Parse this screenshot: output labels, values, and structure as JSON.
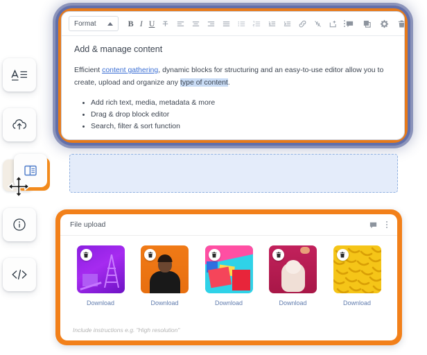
{
  "sidebar": {
    "items": [
      {
        "name": "text-format",
        "label": "Text formatting block"
      },
      {
        "name": "cloud-upload",
        "label": "File upload block"
      },
      {
        "name": "layout-blocks",
        "label": "Layout block"
      },
      {
        "name": "info",
        "label": "Info block"
      },
      {
        "name": "code",
        "label": "Code block"
      }
    ],
    "dragging_item": "layout-blocks",
    "cursor": "move"
  },
  "editor": {
    "toolbar": {
      "format_label": "Format",
      "format_caret": "caret-up",
      "buttons": [
        {
          "name": "bold",
          "glyph": "B"
        },
        {
          "name": "italic",
          "glyph": "I"
        },
        {
          "name": "underline",
          "glyph": "U"
        },
        {
          "name": "strikethrough",
          "glyph": "S"
        },
        {
          "name": "align-left"
        },
        {
          "name": "align-center"
        },
        {
          "name": "align-right"
        },
        {
          "name": "align-justify"
        },
        {
          "name": "bulleted-list"
        },
        {
          "name": "numbered-list"
        },
        {
          "name": "outdent"
        },
        {
          "name": "indent"
        },
        {
          "name": "link"
        },
        {
          "name": "unlink"
        },
        {
          "name": "insert-image"
        },
        {
          "name": "more-options"
        }
      ],
      "right_buttons": [
        {
          "name": "comment"
        },
        {
          "name": "duplicate"
        },
        {
          "name": "settings"
        },
        {
          "name": "delete"
        }
      ]
    },
    "content": {
      "heading": "Add & manage content",
      "paragraph_lead": "Efficient ",
      "paragraph_link": "content gathering",
      "paragraph_mid": ", dynamic blocks for structuring and an easy-to-use editor allow you to create, upload and organize any ",
      "paragraph_highlight": "type of content",
      "paragraph_end": ".",
      "bullets": [
        "Add rich text, media, metadata & more",
        "Drag & drop block editor",
        "Search, filter & sort function"
      ]
    }
  },
  "dropzone": {
    "name": "drop-target",
    "state": "active"
  },
  "upload": {
    "title": "File upload",
    "head_buttons": [
      {
        "name": "comment"
      },
      {
        "name": "more-options"
      }
    ],
    "download_label": "Download",
    "delete_label": "Delete",
    "hint": "Include instructions e.g. \"High resolution\"",
    "thumbnails": [
      {
        "name": "thumb-purple-ladder",
        "art": "art1"
      },
      {
        "name": "thumb-orange-portrait",
        "art": "art2"
      },
      {
        "name": "thumb-abstract-shapes",
        "art": "art3"
      },
      {
        "name": "thumb-pink-poodle",
        "art": "art4"
      },
      {
        "name": "thumb-yellow-bananas",
        "art": "art5"
      }
    ]
  },
  "colors": {
    "accent_orange": "#f2801a",
    "glow_blue": "#5c6aa8",
    "link_blue": "#3b6fd4",
    "highlight_blue": "#c9dcf5",
    "dropzone_bg": "#e4ecfa",
    "download_link": "#5f7bad"
  }
}
